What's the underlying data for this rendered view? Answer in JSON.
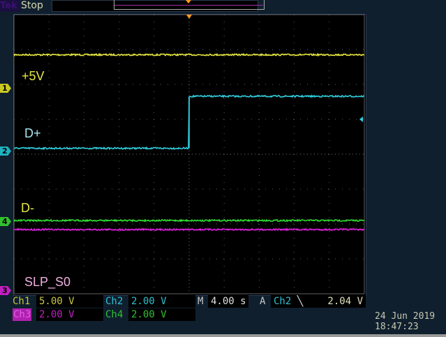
{
  "header": {
    "brand": "Tek",
    "status": "Stop"
  },
  "colors": {
    "ch1": "#e6e640",
    "ch2": "#30d0e0",
    "ch3": "#e020e0",
    "ch4": "#30e030",
    "trigger": "#ff9a20",
    "grid": "#888888"
  },
  "channels": [
    {
      "id": "1",
      "label": "+5V",
      "scale_label": "Ch1",
      "scale": "5.00 V",
      "level_div": 6.85
    },
    {
      "id": "2",
      "label": "D+",
      "scale_label": "Ch2",
      "scale": "2.00 V",
      "low_div": 4.17,
      "high_div": 5.66
    },
    {
      "id": "3",
      "label": "SLP_S0",
      "scale_label": "Ch3",
      "scale": "2.00 V",
      "level_div": 1.84
    },
    {
      "id": "4",
      "label": "D-",
      "scale_label": "Ch4",
      "scale": "2.00 V",
      "level_div": 2.1
    }
  ],
  "timebase": {
    "prefix": "M",
    "value": "4.00 s"
  },
  "trigger": {
    "prefix": "A",
    "source": "Ch2",
    "slope_icon": "falling-edge",
    "level": "2.04 V",
    "position_div": 5.0
  },
  "date": "24 Jun  2019",
  "time": "18:47:23"
}
